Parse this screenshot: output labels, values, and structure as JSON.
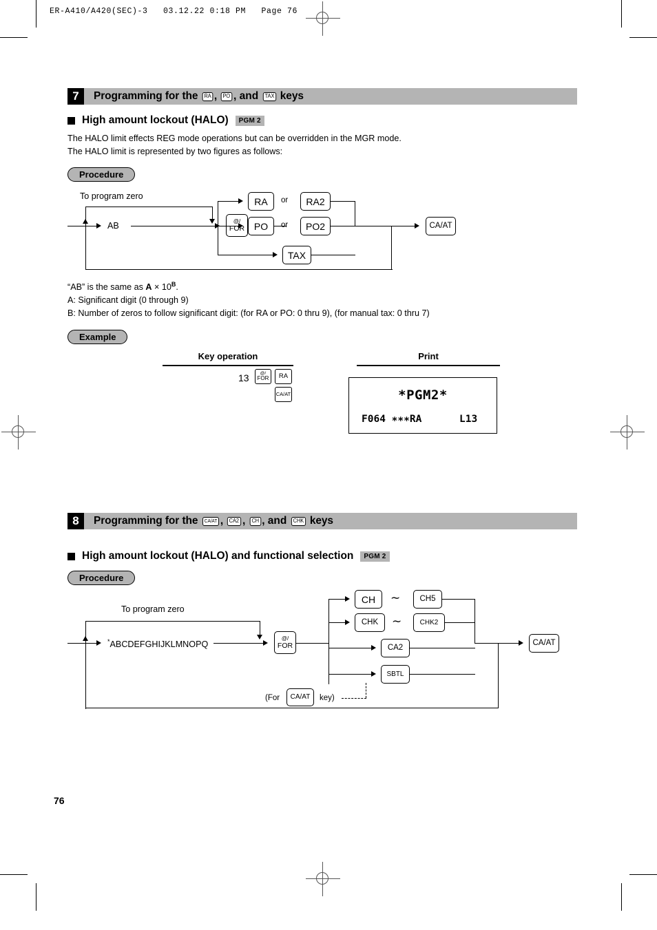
{
  "page": {
    "running_head": "ER-A410/A420(SEC)-3   03.12.22 0:18 PM   Page 76",
    "page_number": "76"
  },
  "section7": {
    "number": "7",
    "title_pre": "Programming for the",
    "key1": "RA",
    "sep1": ",",
    "key2": "PO",
    "sep2": ", and",
    "key3": "TAX",
    "title_post": "keys",
    "subheading": "High amount lockout (HALO)",
    "pgm_badge": "PGM 2",
    "body_line1": "The HALO limit effects REG mode operations but can be overridden in the MGR mode.",
    "body_line2": "The HALO limit is represented by two figures as follows:",
    "procedure_label": "Procedure",
    "diagram": {
      "zero_note": "To program zero",
      "input_label": "AB",
      "for_key_top": "@/",
      "for_key_bottom": "FOR",
      "or_label_1": "or",
      "or_label_2": "or",
      "key_ra": "RA",
      "key_ra2": "RA2",
      "key_po": "PO",
      "key_po2": "PO2",
      "key_tax": "TAX",
      "key_caat": "CA/AT"
    },
    "notes": {
      "ab_line_pre": "“AB” is the same as ",
      "ab_line_a": "A",
      "ab_line_times": " × 10",
      "ab_line_b": "B",
      "ab_line_end": ".",
      "a_line": "A:  Significant digit (0 through 9)",
      "b_line": "B:  Number of zeros to follow significant digit: (for RA or PO: 0 thru 9), (for manual tax: 0 thru 7)"
    },
    "example": {
      "label": "Example",
      "col_keyop": "Key operation",
      "col_print": "Print",
      "keyop_number": "13",
      "keyop_for_top": "@/",
      "keyop_for_bottom": "FOR",
      "keyop_ra": "RA",
      "keyop_caat": "CA/AT",
      "print_line1": "*PGM2*",
      "print_line2_left": "F064 ∗∗∗RA",
      "print_line2_right": "L13"
    }
  },
  "section8": {
    "number": "8",
    "title_pre": "Programming for the",
    "key1": "CA/AT",
    "sep1": ",",
    "key2": "CA2",
    "sep2": ",",
    "key3": "CH",
    "sep3": ", and",
    "key4": "CHK",
    "title_post": "keys",
    "subheading": "High amount lockout (HALO) and functional selection",
    "pgm_badge": "PGM 2",
    "procedure_label": "Procedure",
    "diagram": {
      "zero_note": "To program zero",
      "input_label": "ABCDEFGHIJKLMNOPQ",
      "input_asterisk": "*",
      "for_key_top": "@/",
      "for_key_bottom": "FOR",
      "key_ch": "CH",
      "tilde_1": "∼",
      "key_ch5": "CH5",
      "key_chk": "CHK",
      "tilde_2": "∼",
      "key_chk2": "CHK2",
      "key_ca2": "CA2",
      "key_sbtl": "SBTL",
      "key_caat": "CA/AT",
      "for_note_pre": "(For",
      "for_note_key": "CA/AT",
      "for_note_post": "key)"
    }
  }
}
